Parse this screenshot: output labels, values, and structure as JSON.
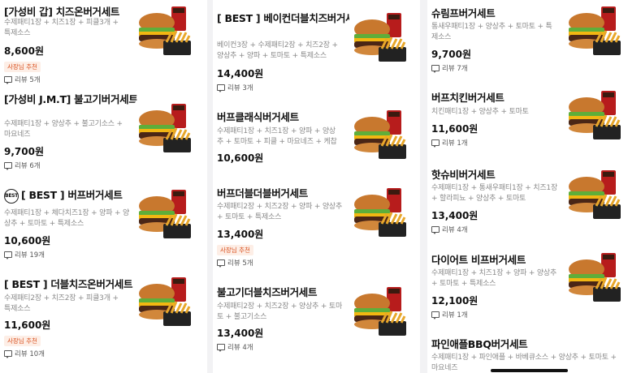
{
  "review_prefix": "리뷰",
  "colors": {
    "accent": "#d9501e",
    "badge_bg": "#fdeee6"
  },
  "columns": [
    {
      "items": [
        {
          "name": "[가성비 갑] 치즈온버거세트",
          "desc": "수제패티1장 + 치즈1장 + 피클3개 + 특제소스",
          "price": "8,600원",
          "badge": "사장님 추천",
          "reviews": "리뷰 5개"
        },
        {
          "name": "[가성비 J.M.T] 불고기버거세트",
          "desc": "수제패티1장 + 양상추 + 불고기소스 + 마요네즈",
          "price": "9,700원",
          "badge": "",
          "reviews": "리뷰 6개"
        },
        {
          "name": "[ BEST ] 버프버거세트",
          "desc": "수제패티1장 + 체다치즈1장 + 양파 + 양상추 + 토마토 + 특제소스",
          "price": "10,600원",
          "badge": "",
          "reviews": "리뷰 19개",
          "stamp": "BEST"
        },
        {
          "name": "[ BEST ] 더블치즈온버거세트",
          "desc": "수제패티2장 + 치즈2장 + 피클3개 + 특제소스",
          "price": "11,600원",
          "badge": "사장님 추천",
          "reviews": "리뷰 10개"
        }
      ]
    },
    {
      "items": [
        {
          "name": "[ BEST ] 베이컨더블치즈버거세트",
          "desc": "베이컨3장 + 수제패티2장 + 치즈2장 + 양상추 + 양파 + 토마토 + 특제소스",
          "price": "14,400원",
          "badge": "",
          "reviews": "리뷰 3개"
        },
        {
          "name": "버프클래식버거세트",
          "desc": "수제패티1장 + 치즈1장 + 양파 + 양상추 + 토마토 + 피클 + 마요네즈 + 케찹",
          "price": "10,600원",
          "badge": "",
          "reviews": ""
        },
        {
          "name": "버프더블더블버거세트",
          "desc": "수제패티2장 + 치즈2장 + 양파 + 양상추 + 토마토 + 특제소스",
          "price": "13,400원",
          "badge": "사장님 추천",
          "reviews": "리뷰 5개"
        },
        {
          "name": "불고기더블치즈버거세트",
          "desc": "수제패티2장 + 치즈2장 + 양상추 + 토마토 + 불고기소스",
          "price": "13,400원",
          "badge": "",
          "reviews": "리뷰 4개"
        }
      ]
    },
    {
      "items": [
        {
          "name": "슈림프버거세트",
          "desc": "통새우패티1장 + 양상추 + 토마토 + 특제소스",
          "price": "9,700원",
          "badge": "",
          "reviews": "리뷰 7개"
        },
        {
          "name": "버프치킨버거세트",
          "desc": "치킨패티1장 + 양상추 + 토마토",
          "price": "11,600원",
          "badge": "",
          "reviews": "리뷰 1개"
        },
        {
          "name": "핫슈비버거세트",
          "desc": "수제패티1장 + 통새우패티1장 + 치즈1장 + 할라피뇨 + 양상추 + 토마토",
          "price": "13,400원",
          "badge": "",
          "reviews": "리뷰 4개"
        },
        {
          "name": "다이어트 비프버거세트",
          "desc": "수제패티1장 + 치즈1장 + 양파 + 양상추 + 토마토 + 특제소스",
          "price": "12,100원",
          "badge": "",
          "reviews": "리뷰 1개"
        },
        {
          "name": "파인애플BBQ버거세트",
          "desc": "수제패티1장 + 파인애플 + 바베큐소스 + 양상추 + 토마토 + 마요네즈",
          "price": "",
          "badge": "",
          "reviews": ""
        }
      ]
    }
  ]
}
